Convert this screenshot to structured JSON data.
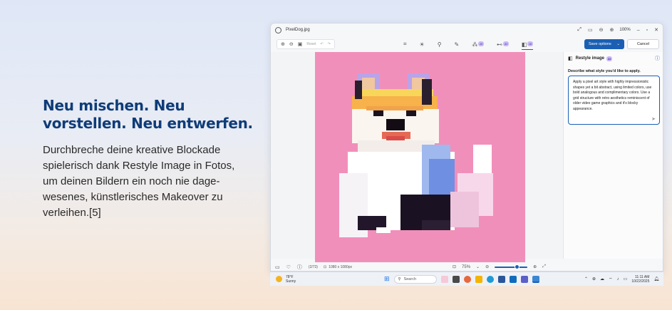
{
  "promo": {
    "heading": "Neu mischen. Neu vorstellen. Neu entwerfen.",
    "body": "Durchbreche deine kreative Blockade spielerisch dank Restyle Image in Fotos, um deinen Bildern ein noch nie dage-wesenes, künstlerisches Makeover zu verleihen.[5]"
  },
  "window": {
    "filename": "PixelDog.jpg",
    "zoom_level": "100%",
    "reset_label": "Reset",
    "save_label": "Save options",
    "cancel_label": "Cancel",
    "ai_badge": "AI"
  },
  "panel": {
    "title": "Restyle image",
    "ai_badge": "AI",
    "prompt_label": "Describe what style you'd like to apply.",
    "prompt_text": "Apply a pixel art style with highly impressionistic shapes yet a bit abstract, using limited colors, use bold analogous and complimentary colors. Use a grid structure with retro aesthetics reminiscent of older video game graphics and it's blocky appearance."
  },
  "status": {
    "counter": "(2/73)",
    "dimensions": "1080 x 1080px",
    "zoom_percent": "75%"
  },
  "taskbar": {
    "temperature": "78°F",
    "condition": "Sunny",
    "search_placeholder": "Search",
    "time": "11:11 AM",
    "date": "10/22/2025"
  },
  "colors": {
    "heading": "#0f3c78",
    "accent": "#1a5fb4",
    "image_background": "#f18fbb"
  }
}
